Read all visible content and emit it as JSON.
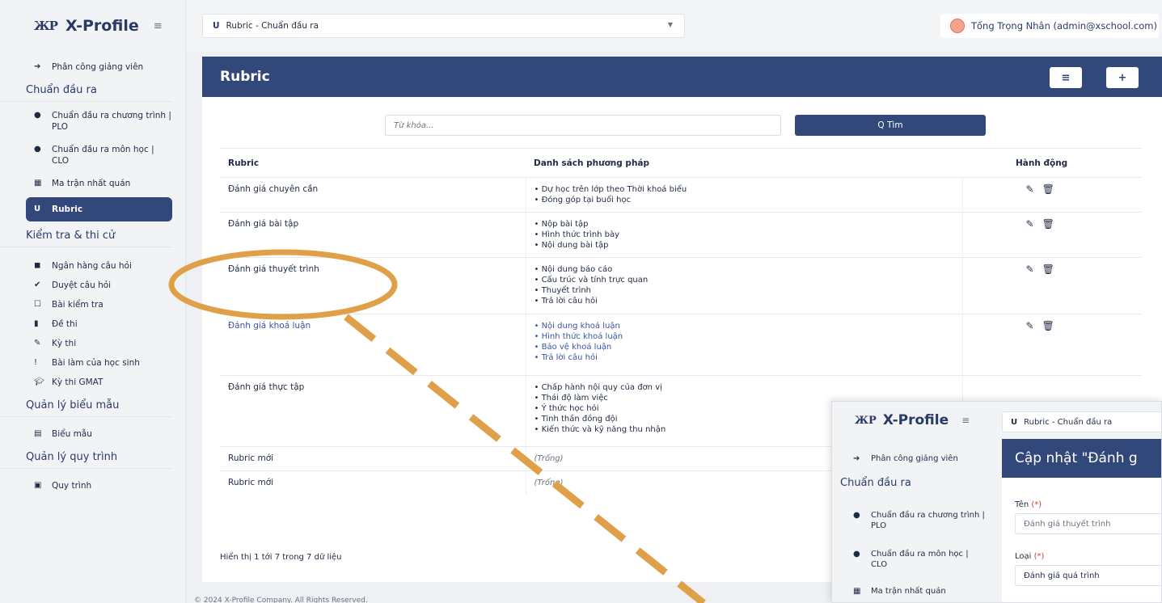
{
  "sidebar": {
    "brand_mark": "ЖР",
    "brand": "X-Profile",
    "top_item": "Phân công giảng viên",
    "sections": [
      {
        "title": "Chuẩn đầu ra"
      },
      {
        "title": "Kiểm tra & thi cử"
      },
      {
        "title": "Quản lý biểu mẫu"
      },
      {
        "title": "Quản lý quy trình"
      }
    ],
    "items": [
      "Chuẩn đầu ra chương trình | PLO",
      "Chuẩn đầu ra môn học | CLO",
      "Ma trận nhất quán",
      "Rubric",
      "Ngân hàng câu hỏi",
      "Duyệt câu hỏi",
      "Bài kiểm tra",
      "Đề thi",
      "Kỳ thi",
      "Bài làm của học sinh",
      "Kỳ thi GMAT",
      "Biểu mẫu",
      "Quy trình"
    ]
  },
  "topbar": {
    "selected_rubric": "Rubric - Chuẩn đầu ra",
    "user": "Tống Trọng Nhân (admin@xschool.com)"
  },
  "main": {
    "title": "Rubric",
    "search_placeholder": "Từ khóa...",
    "search_button": "Q Tìm",
    "headers": [
      "Rubric",
      "Danh sách phương pháp",
      "Hành động"
    ],
    "rows": [
      {
        "name": "Đánh giá chuyên cần",
        "methods": [
          "• Dự học trên lớp theo Thời khoá biểu",
          "• Đóng góp tại buổi học"
        ]
      },
      {
        "name": "Đánh giá bài tập",
        "methods": [
          "• Nộp bài tập",
          "• Hình thức trình bày",
          "• Nội dung bài tập"
        ]
      },
      {
        "name": "Đánh giá thuyết trình",
        "methods": [
          "• Nội dung báo cáo",
          "• Cấu trúc và tính trực quan",
          "• Thuyết trình",
          "• Trả lời câu hỏi"
        ]
      },
      {
        "name": "Đánh giá khoá luận",
        "methods": [
          "• Nội dung khoá luận",
          "• Hình thức khoá luận",
          "• Bảo vệ khoá luận",
          "• Trả lời câu hỏi"
        ]
      },
      {
        "name": "Đánh giá thực tập",
        "methods": [
          "• Chấp hành nội quy của đơn vị",
          "• Thái độ làm việc",
          "• Ý thức học hỏi",
          "• Tinh thần đồng đội",
          "• Kiến thức và kỹ năng thu nhận"
        ]
      },
      {
        "name": "Rubric mới",
        "methods": [
          "(Trống)"
        ]
      },
      {
        "name": "Rubric mới",
        "methods": [
          "(Trống)"
        ]
      }
    ],
    "footer_count": "Hiển thị 1 tới 7 trong 7 dữ liệu",
    "copyright": "© 2024 X-Profile Company. All Rights Reserved."
  },
  "overlay": {
    "brand": "X-Profile",
    "top_item": "Phân công giảng viên",
    "section": "Chuẩn đầu ra",
    "items": [
      "Chuẩn đầu ra chương trình | PLO",
      "Chuẩn đầu ra môn học | CLO",
      "Ma trận nhất quán"
    ],
    "select": "Rubric - Chuẩn đầu ra",
    "title": "Cập nhật \"Đánh g",
    "name_label": "Tên",
    "name_value": "Đánh giá thuyết trình",
    "type_label": "Loại",
    "type_value": "Đánh giá quá trình",
    "required_mark": "(*)"
  },
  "colors": {
    "primary": "#33487a",
    "annotation": "#e0a04a"
  }
}
